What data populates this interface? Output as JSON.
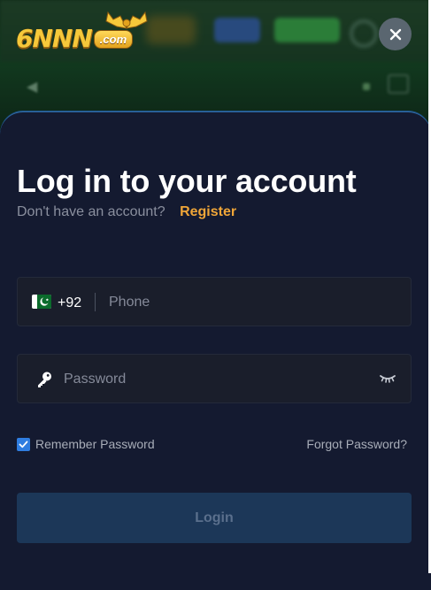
{
  "brand": {
    "logo_text": "6NNN",
    "logo_suffix": ".com"
  },
  "header": {
    "close_icon": "close-icon"
  },
  "login": {
    "title": "Log in to your account",
    "no_account_text": "Don't have an account?",
    "register_link": "Register",
    "phone": {
      "country_flag": "pakistan-flag-icon",
      "dial_code": "+92",
      "placeholder": "Phone",
      "value": ""
    },
    "password": {
      "placeholder": "Password",
      "value": "",
      "leading_icon": "key-icon",
      "toggle_icon": "eye-closed-icon"
    },
    "remember_label": "Remember Password",
    "remember_checked": true,
    "forgot_link": "Forgot Password?",
    "submit_label": "Login"
  },
  "colors": {
    "accent": "#f0a638",
    "sheet_bg": "#141a30",
    "field_bg": "#1a1e2b",
    "button_bg": "#1c3758",
    "checkbox": "#2f7de0"
  }
}
